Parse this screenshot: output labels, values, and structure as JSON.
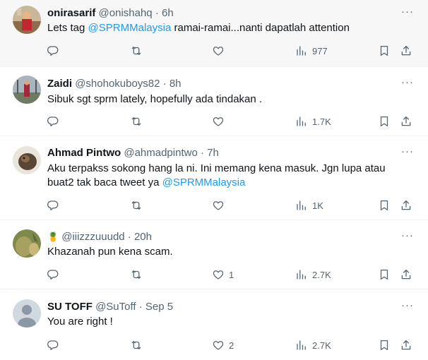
{
  "tweets": [
    {
      "name": "onirasarif",
      "handle": "@onishahq",
      "dot": "·",
      "time": "6h",
      "text_before": "Lets tag ",
      "mention": "@SPRMMalaysia",
      "text_after": " ramai-ramai...nanti dapatlah attention",
      "replies": "",
      "retweets": "",
      "likes": "",
      "views": "977"
    },
    {
      "name": "Zaidi",
      "handle": "@shohokuboys82",
      "dot": "·",
      "time": "8h",
      "text": "Sibuk sgt sprm lately, hopefully ada tindakan .",
      "replies": "",
      "retweets": "",
      "likes": "",
      "views": "1.7K"
    },
    {
      "name": "Ahmad Pintwo",
      "handle": "@ahmadpintwo",
      "dot": "·",
      "time": "7h",
      "text_line1": "Aku terpakss sokong hang la ni. Ini memang kena masuk. Jgn lupa atau",
      "text_line2_before": "buat2 tak baca tweet ya ",
      "mention": "@SPRMMalaysia",
      "replies": "",
      "retweets": "",
      "likes": "",
      "views": "1K"
    },
    {
      "name": "🍍",
      "handle": "@iiizzzuuudd",
      "dot": "·",
      "time": "20h",
      "text": "Khazanah pun kena scam.",
      "replies": "",
      "retweets": "",
      "likes": "1",
      "views": "2.7K"
    },
    {
      "name": "SU TOFF",
      "handle": "@SuToff",
      "dot": "·",
      "time": "Sep 5",
      "text": "You are right !",
      "replies": "",
      "retweets": "",
      "likes": "2",
      "views": "2.7K"
    }
  ],
  "icons": {
    "more": "more-icon",
    "reply": "reply-icon",
    "retweet": "retweet-icon",
    "like": "heart-icon",
    "views": "views-icon",
    "bookmark": "bookmark-icon",
    "share": "share-icon"
  },
  "colors": {
    "mention": "#1d9bf0",
    "secondary": "#536471",
    "highlight_bg": "#f7f7f7"
  }
}
